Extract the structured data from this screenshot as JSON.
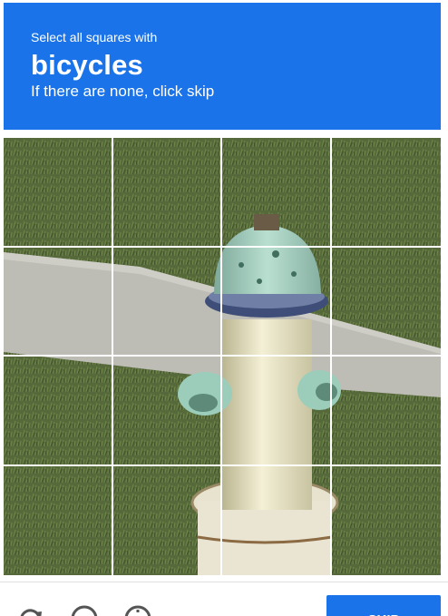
{
  "header": {
    "instruction": "Select all squares with",
    "target": "bicycles",
    "subtext": "If there are none, click skip"
  },
  "grid": {
    "rows": 4,
    "cols": 4,
    "image_subject": "fire-hydrant-on-grass"
  },
  "footer": {
    "icons": [
      "reload-icon",
      "audio-icon",
      "info-icon"
    ],
    "skip_label": "SKIP"
  },
  "colors": {
    "accent": "#1a73e8",
    "header_text": "#ffffff"
  }
}
